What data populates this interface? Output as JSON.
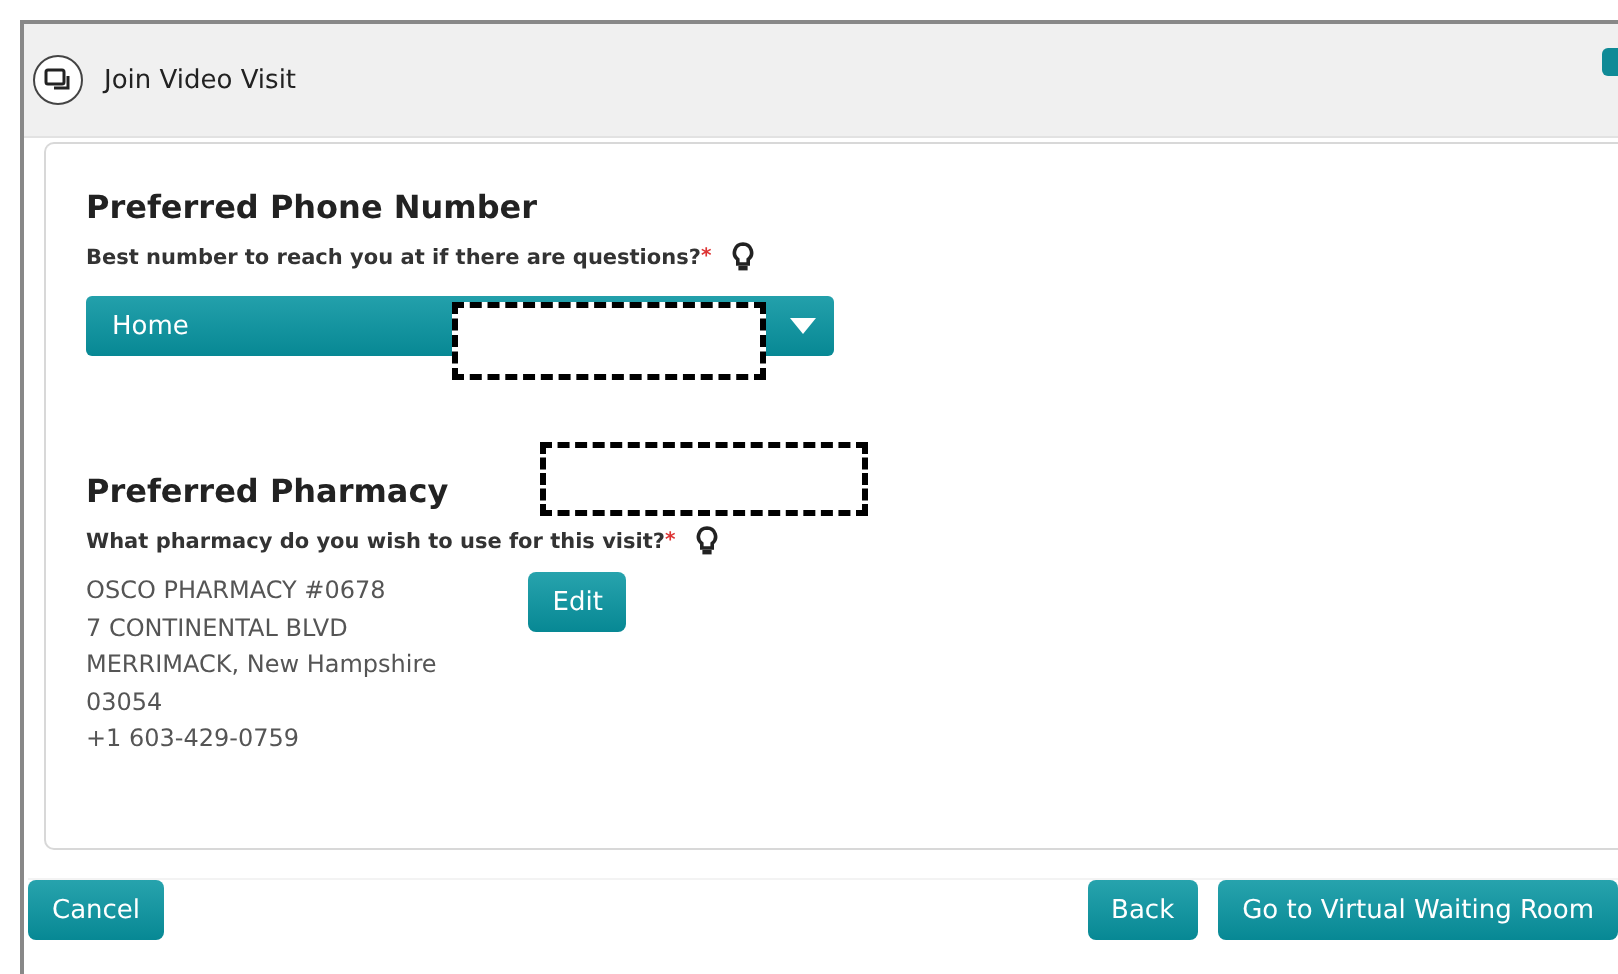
{
  "window": {
    "title": "Join Video Visit"
  },
  "phone": {
    "heading": "Preferred Phone Number",
    "question": "Best number to reach you at if there are questions?",
    "required_mark": "*",
    "dropdown": {
      "value": "Home"
    }
  },
  "pharmacy": {
    "heading": "Preferred Pharmacy",
    "question": "What pharmacy do you wish to use for this visit?",
    "required_mark": "*",
    "address_lines": [
      "OSCO PHARMACY #0678",
      "7 CONTINENTAL BLVD",
      "MERRIMACK, New Hampshire",
      "03054",
      "+1 603-429-0759"
    ],
    "edit_button": "Edit"
  },
  "footer": {
    "cancel": "Cancel",
    "back": "Back",
    "next": "Go to Virtual Waiting Room"
  }
}
